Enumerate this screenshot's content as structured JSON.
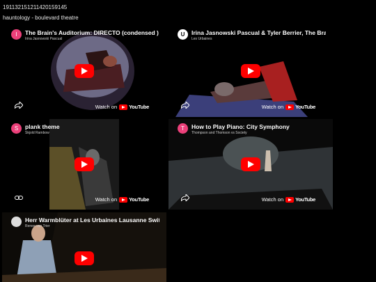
{
  "header": {
    "id_text": "191132151211420159145",
    "tagline": "hauntology - boulevard theatre"
  },
  "embeds": [
    {
      "title": "The Brain's Auditorium: DIRECTO (condensed )",
      "channel": "Irina Jasnowski Pascual",
      "avatar_letter": "I",
      "avatar_color": "#ec407a",
      "watch_label": "Watch on",
      "yt_label": "YouTube",
      "action_icon": "share-icon"
    },
    {
      "title": "Irina Jasnowski Pascual & Tyler Berrier, The Brain",
      "channel": "Les Urbaines",
      "avatar_letter": "U",
      "avatar_color": "#ffffff",
      "watch_label": "Watch on",
      "yt_label": "YouTube",
      "action_icon": "share-icon"
    },
    {
      "title": "plank theme",
      "channel": "Skjold Rambow",
      "avatar_letter": "S",
      "avatar_color": "#ec407a",
      "watch_label": "Watch on",
      "yt_label": "YouTube",
      "action_icon": "link-icon"
    },
    {
      "title": "How to Play Piano: City Symphony",
      "channel": "Thompson and Thomson vs Society",
      "avatar_letter": "T",
      "avatar_color": "#ec407a",
      "watch_label": "Watch on",
      "yt_label": "YouTube",
      "action_icon": "share-icon"
    },
    {
      "title": "Herr Warmblüter at Les Urbaines Lausanne Switzerl",
      "channel": "Renee van Trier",
      "avatar_letter": "",
      "avatar_color": "#dddddd",
      "watch_label": "",
      "yt_label": "",
      "action_icon": ""
    }
  ]
}
